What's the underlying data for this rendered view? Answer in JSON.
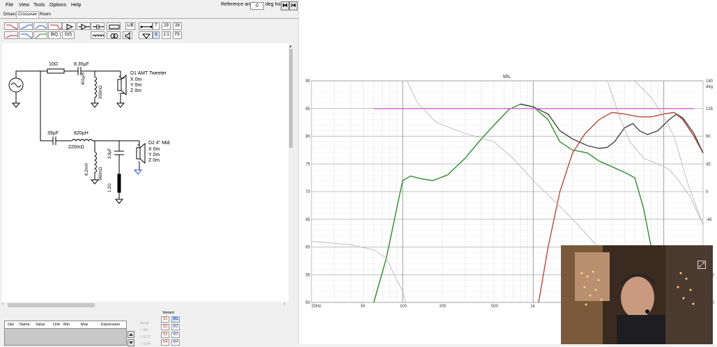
{
  "menu": [
    "File",
    "View",
    "Tools",
    "Options",
    "Help"
  ],
  "reference_angle": {
    "label": "Reference angle",
    "value": "0",
    "unit": "deg hor"
  },
  "tabs": [
    "Drivers",
    "Crossover",
    "Room"
  ],
  "toolbar": {
    "biq": "BiQ",
    "gf": "G(f)",
    "lb": "L/B",
    "t": "T",
    "v29": "29",
    "v28": "28",
    "x": "X",
    "ratio": "1:1",
    "fit": "Fit"
  },
  "schematic": {
    "r1": "10Ω",
    "c1": "8.35µF",
    "l1": "401µH",
    "l1_r": "200mΩ",
    "d1_name": "D1 AMT Tweeter",
    "d1_x": "X 0m",
    "d1_y": "Y 0m",
    "d1_z": "Z 0m",
    "c2": "39µF",
    "l2": "820µH",
    "l2_r": "220mΩ",
    "l3": "8.2mH",
    "l3_r": "560mΩ",
    "c3": "3.9µF",
    "r2": "1.2Ω",
    "d2_name": "D2 4\" Mid",
    "d2_x": "X 0m",
    "d2_y": "Y 0m",
    "d2_z": "Z 0m",
    "plus": "+",
    "minus": "-"
  },
  "opt_table": {
    "headers": [
      "Opt",
      "Name",
      "Value",
      "Unit",
      "Min",
      "Max",
      "Expression"
    ]
  },
  "snap": {
    "label": "Snap",
    "e6": "E6",
    "e12": "E12",
    "e24": "E24"
  },
  "variant": {
    "label": "Variant",
    "s": [
      "S1",
      "S2",
      "S3",
      "S4"
    ],
    "r": [
      "R1",
      "R2",
      "R3",
      "R4"
    ]
  },
  "chart_data": {
    "type": "line",
    "title": "SPL",
    "xscale": "log",
    "xlim": [
      20,
      20000
    ],
    "x_tick_labels": [
      "20Hz",
      "50",
      "100",
      "200",
      "500",
      "1k"
    ],
    "ylim": [
      50,
      90
    ],
    "y_ticks": [
      90,
      85,
      80,
      75,
      70,
      65,
      60,
      55,
      50
    ],
    "y2lim": [
      -180,
      180
    ],
    "y2_ticks": [
      180,
      135,
      90,
      45,
      0,
      -45,
      -90,
      -135,
      -180
    ],
    "y2_unit": "deg",
    "grid": true,
    "series": [
      {
        "color": "#2e8b2e",
        "points": [
          [
            60,
            50
          ],
          [
            75,
            58
          ],
          [
            90,
            67
          ],
          [
            100,
            72
          ],
          [
            115,
            72.8
          ],
          [
            140,
            72.3
          ],
          [
            170,
            72
          ],
          [
            220,
            73
          ],
          [
            300,
            76
          ],
          [
            400,
            79.5
          ],
          [
            500,
            82
          ],
          [
            650,
            84.8
          ],
          [
            800,
            85.8
          ],
          [
            1000,
            85.3
          ],
          [
            1300,
            83
          ],
          [
            1600,
            79
          ],
          [
            2000,
            77.5
          ],
          [
            2600,
            77
          ],
          [
            3200,
            75.5
          ],
          [
            4000,
            74.5
          ],
          [
            5000,
            73.5
          ],
          [
            6000,
            72.5
          ],
          [
            7000,
            67
          ],
          [
            8000,
            60
          ],
          [
            9000,
            52
          ]
        ]
      },
      {
        "color": "#b84a3a",
        "points": [
          [
            1100,
            50
          ],
          [
            1300,
            60
          ],
          [
            1600,
            70
          ],
          [
            2000,
            77
          ],
          [
            2500,
            80.5
          ],
          [
            3200,
            83
          ],
          [
            4000,
            84.3
          ],
          [
            5000,
            84
          ],
          [
            6500,
            83.5
          ],
          [
            8000,
            83.5
          ],
          [
            10000,
            84
          ],
          [
            12000,
            84.3
          ],
          [
            14000,
            83
          ],
          [
            17000,
            80
          ],
          [
            20000,
            77
          ]
        ]
      },
      {
        "color": "#444444",
        "points": [
          [
            800,
            85.8
          ],
          [
            1000,
            85.3
          ],
          [
            1300,
            84
          ],
          [
            1600,
            81
          ],
          [
            2000,
            79.5
          ],
          [
            2600,
            78.3
          ],
          [
            3200,
            77.8
          ],
          [
            3700,
            78
          ],
          [
            4200,
            79
          ],
          [
            5000,
            81.5
          ],
          [
            5800,
            82.3
          ],
          [
            6500,
            81
          ],
          [
            7500,
            80.3
          ],
          [
            9000,
            81
          ],
          [
            11000,
            83
          ],
          [
            12500,
            84
          ],
          [
            14000,
            83.3
          ],
          [
            17000,
            80.5
          ],
          [
            20000,
            77
          ]
        ]
      },
      {
        "color": "#d060d0",
        "points": [
          [
            60,
            85
          ],
          [
            17000,
            85
          ]
        ]
      },
      {
        "color": "#b8b8b8",
        "points": [
          [
            20,
            61
          ],
          [
            40,
            60.4
          ],
          [
            60,
            59.5
          ],
          [
            75,
            58
          ],
          [
            90,
            54
          ],
          [
            100,
            52
          ],
          [
            105,
            50
          ]
        ]
      },
      {
        "color": "#b8b8b8",
        "points": [
          [
            108,
            90
          ],
          [
            130,
            86
          ],
          [
            180,
            82.5
          ],
          [
            300,
            80.5
          ],
          [
            500,
            79
          ],
          [
            700,
            76
          ],
          [
            1000,
            72
          ],
          [
            1500,
            68
          ],
          [
            2200,
            64
          ],
          [
            3000,
            60.5
          ],
          [
            4000,
            58
          ],
          [
            5000,
            55.5
          ],
          [
            6000,
            52
          ]
        ]
      },
      {
        "color": "#b8b8b8",
        "points": [
          [
            3700,
            90
          ],
          [
            4500,
            84
          ],
          [
            5500,
            79
          ],
          [
            7000,
            76
          ],
          [
            9000,
            75
          ],
          [
            11000,
            74
          ],
          [
            13000,
            72
          ],
          [
            16000,
            69
          ],
          [
            20000,
            64
          ]
        ]
      },
      {
        "color": "#b8b8b8",
        "points": [
          [
            6000,
            90
          ],
          [
            8000,
            87
          ],
          [
            10000,
            83.5
          ],
          [
            12000,
            80
          ],
          [
            15000,
            72
          ],
          [
            20000,
            64
          ]
        ]
      }
    ]
  },
  "video_overlay": {
    "expand_icon": "expand-icon"
  }
}
